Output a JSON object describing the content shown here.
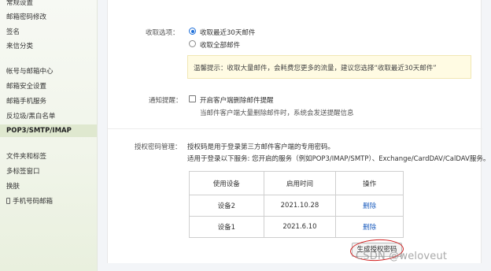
{
  "sidebar": {
    "items": [
      {
        "label": "常规设置"
      },
      {
        "label": "邮箱密码修改"
      },
      {
        "label": "签名"
      },
      {
        "label": "来信分类"
      },
      {
        "label": "帐号与邮箱中心"
      },
      {
        "label": "邮箱安全设置"
      },
      {
        "label": "邮箱手机服务"
      },
      {
        "label": "反垃圾/黑白名单"
      },
      {
        "label": "POP3/SMTP/IMAP"
      },
      {
        "label": "文件夹和标签"
      },
      {
        "label": "多标签窗口"
      },
      {
        "label": "换肤"
      },
      {
        "label": "手机号码邮箱"
      }
    ],
    "active_index": 8
  },
  "receive": {
    "label": "收取选项：",
    "options": [
      {
        "label": "收取最近30天邮件",
        "selected": true
      },
      {
        "label": "收取全部邮件",
        "selected": false
      }
    ],
    "tip": "温馨提示：收取大量邮件，会耗费您更多的流量，建议您选择“收取最近30天邮件”"
  },
  "notify": {
    "label": "通知提醒：",
    "checkbox_label": "开启客户端删除邮件提醒",
    "checked": false,
    "desc": "当邮件客户端大量删除邮件时，系统会发送提醒信息"
  },
  "auth": {
    "label": "授权密码管理：",
    "line1": "授权码是用于登录第三方邮件客户端的专用密码。",
    "line2": "适用于登录以下服务: 您开启的服务（例如POP3/IMAP/SMTP）、Exchange/CardDAV/CalDAV服务。",
    "table": {
      "headers": [
        "使用设备",
        "启用时间",
        "操作"
      ],
      "rows": [
        {
          "device": "设备2",
          "date": "2021.10.28",
          "action": "删除"
        },
        {
          "device": "设备1",
          "date": "2021.6.10",
          "action": "删除"
        }
      ]
    },
    "generate_button": "生成授权密码"
  },
  "watermark": "CSDN @weloveut",
  "colors": {
    "accent": "#1e6fd9",
    "link": "#1f5fbf",
    "annotation": "#d21e1e",
    "tip_bg": "#fffbe3",
    "active_nav_bg": "#dfe8cf"
  }
}
